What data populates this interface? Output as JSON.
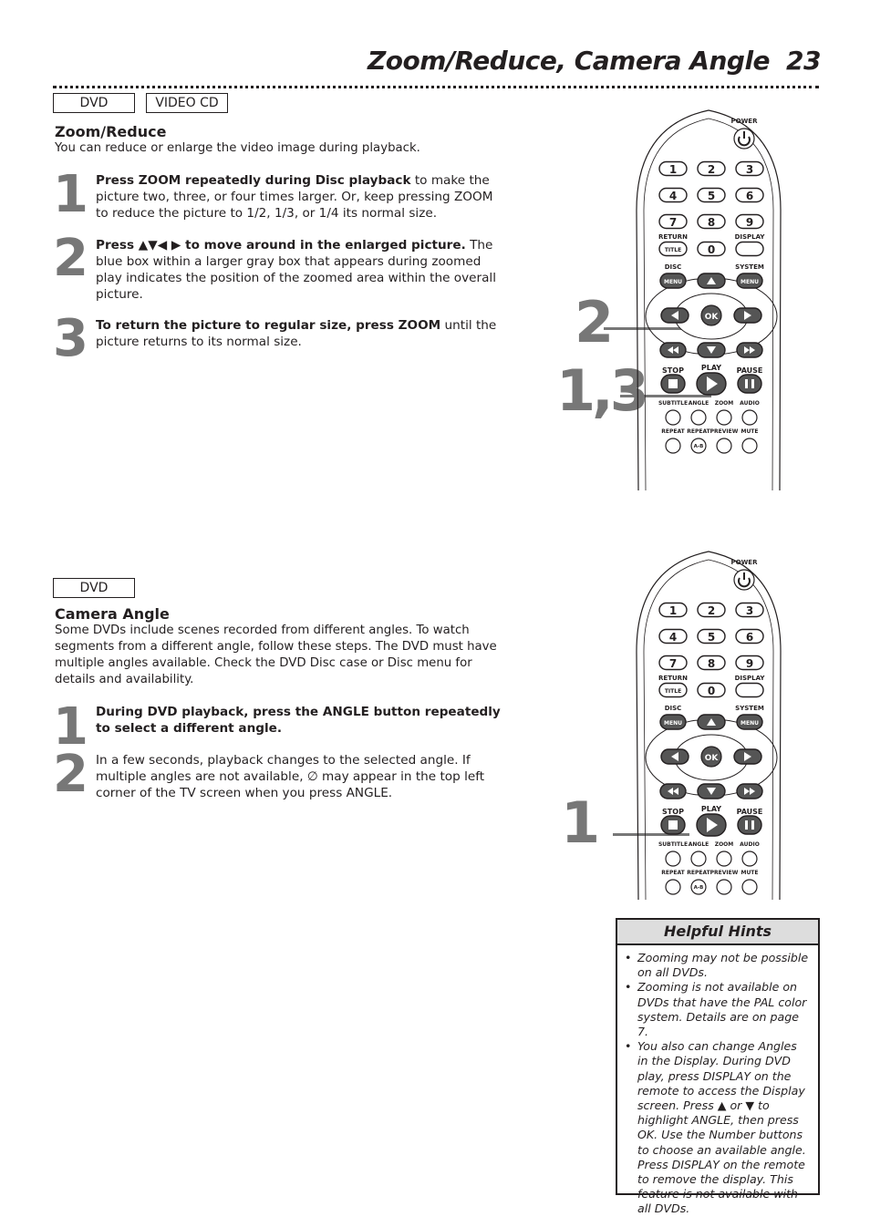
{
  "header": {
    "title": "Zoom/Reduce, Camera Angle",
    "page_number": "23"
  },
  "zoom_section": {
    "tags": [
      "DVD",
      "VIDEO CD"
    ],
    "heading": "Zoom/Reduce",
    "intro": "You can reduce or enlarge the video image during playback.",
    "steps": [
      {
        "num": "1",
        "bold": "Press ZOOM repeatedly during Disc playback",
        "text": " to make the picture two, three, or four times larger. Or, keep pressing ZOOM to reduce the picture to 1/2, 1/3, or 1/4 its normal size."
      },
      {
        "num": "2",
        "bold": "Press ▲▼◀ ▶ to move around in the enlarged picture.",
        "text": " The blue box within a larger gray box that appears during zoomed play indicates the position of the zoomed area within the overall picture."
      },
      {
        "num": "3",
        "bold": "To return the picture to regular size, press ZOOM",
        "text": " until the picture returns to its normal size."
      }
    ],
    "callouts": [
      "2",
      "1,3"
    ]
  },
  "angle_section": {
    "tags": [
      "DVD"
    ],
    "heading": "Camera Angle",
    "intro": "Some DVDs include scenes recorded from different angles. To watch segments from a different angle, follow these steps. The DVD must have multiple angles available. Check the DVD Disc case or Disc menu for details and availability.",
    "steps": [
      {
        "num": "1",
        "bold": "During DVD playback, press the ANGLE button repeatedly to select a different angle.",
        "text": ""
      },
      {
        "num": "2",
        "bold": "",
        "text": "In a few seconds, playback changes to the selected angle. If multiple angles are not available, ∅ may appear in the top left corner of the TV screen when you press ANGLE."
      }
    ],
    "callouts": [
      "1"
    ]
  },
  "remote": {
    "power": "POWER",
    "digits": [
      "1",
      "2",
      "3",
      "4",
      "5",
      "6",
      "7",
      "8",
      "9",
      "0"
    ],
    "return_label": "RETURN",
    "title_btn": "TITLE",
    "display_label": "DISPLAY",
    "disc_label": "DISC",
    "system_label": "SYSTEM",
    "menu_btn": "MENU",
    "ok_btn": "OK",
    "stop_label": "STOP",
    "play_label": "PLAY",
    "pause_label": "PAUSE",
    "row1_labels": [
      "SUBTITLE",
      "ANGLE",
      "ZOOM",
      "AUDIO"
    ],
    "row2_labels": [
      "REPEAT",
      "REPEAT",
      "PREVIEW",
      "MUTE"
    ],
    "ab_btn": "A-B"
  },
  "hints": {
    "title": "Helpful Hints",
    "items": [
      "Zooming may not be possible on all DVDs.",
      "Zooming is not available on DVDs that have the PAL color system. Details are on page 7.",
      "You also can change Angles in the Display. During DVD play, press DISPLAY on the remote to access the Display screen. Press ▲ or ▼ to highlight ANGLE, then press OK. Use the Number buttons to choose an available angle. Press DISPLAY on the remote to remove the display. This feature is not available with all DVDs."
    ]
  }
}
